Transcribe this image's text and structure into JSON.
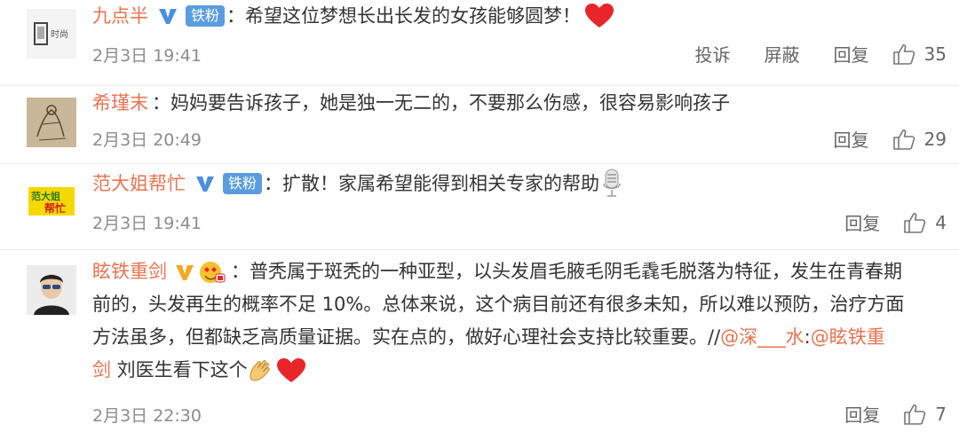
{
  "comments": [
    {
      "username": "九点半",
      "badge": "铁粉",
      "text": "：希望这位梦想长出长发的女孩能够圆梦！",
      "time": "2月3日 19:41",
      "report": "投诉",
      "block": "屏蔽",
      "reply": "回复",
      "likes": "35"
    },
    {
      "username": "希瑾末",
      "text": "：妈妈要告诉孩子，她是独一无二的，不要那么伤感，很容易影响孩子",
      "time": "2月3日 20:49",
      "reply": "回复",
      "likes": "29"
    },
    {
      "username": "范大姐帮忙",
      "badge": "铁粉",
      "text": "：扩散！家属希望能得到相关专家的帮助",
      "time": "2月3日 19:41",
      "reply": "回复",
      "likes": "4"
    },
    {
      "username": "眩铁重剑",
      "text_line1": "：普秃属于斑秃的一种亚型，以头发眉毛腋毛阴毛毳毛脱落为特征，发生在青春期",
      "text_line2": "前的，头发再生的概率不足 10%。总体来说，这个病目前还有很多未知，所以难以预防，治疗方面",
      "text_line3": "方法虽多，但都缺乏高质量证据。实在点的，做好心理社会支持比较重要。//",
      "mention1": "@深___水",
      "colon": ":",
      "mention2_part1": "@眩铁重",
      "mention2_part2": "剑",
      "text_tail": " 刘医生看下这个",
      "time": "2月3日 22:30",
      "reply": "回复",
      "likes": "7"
    }
  ]
}
